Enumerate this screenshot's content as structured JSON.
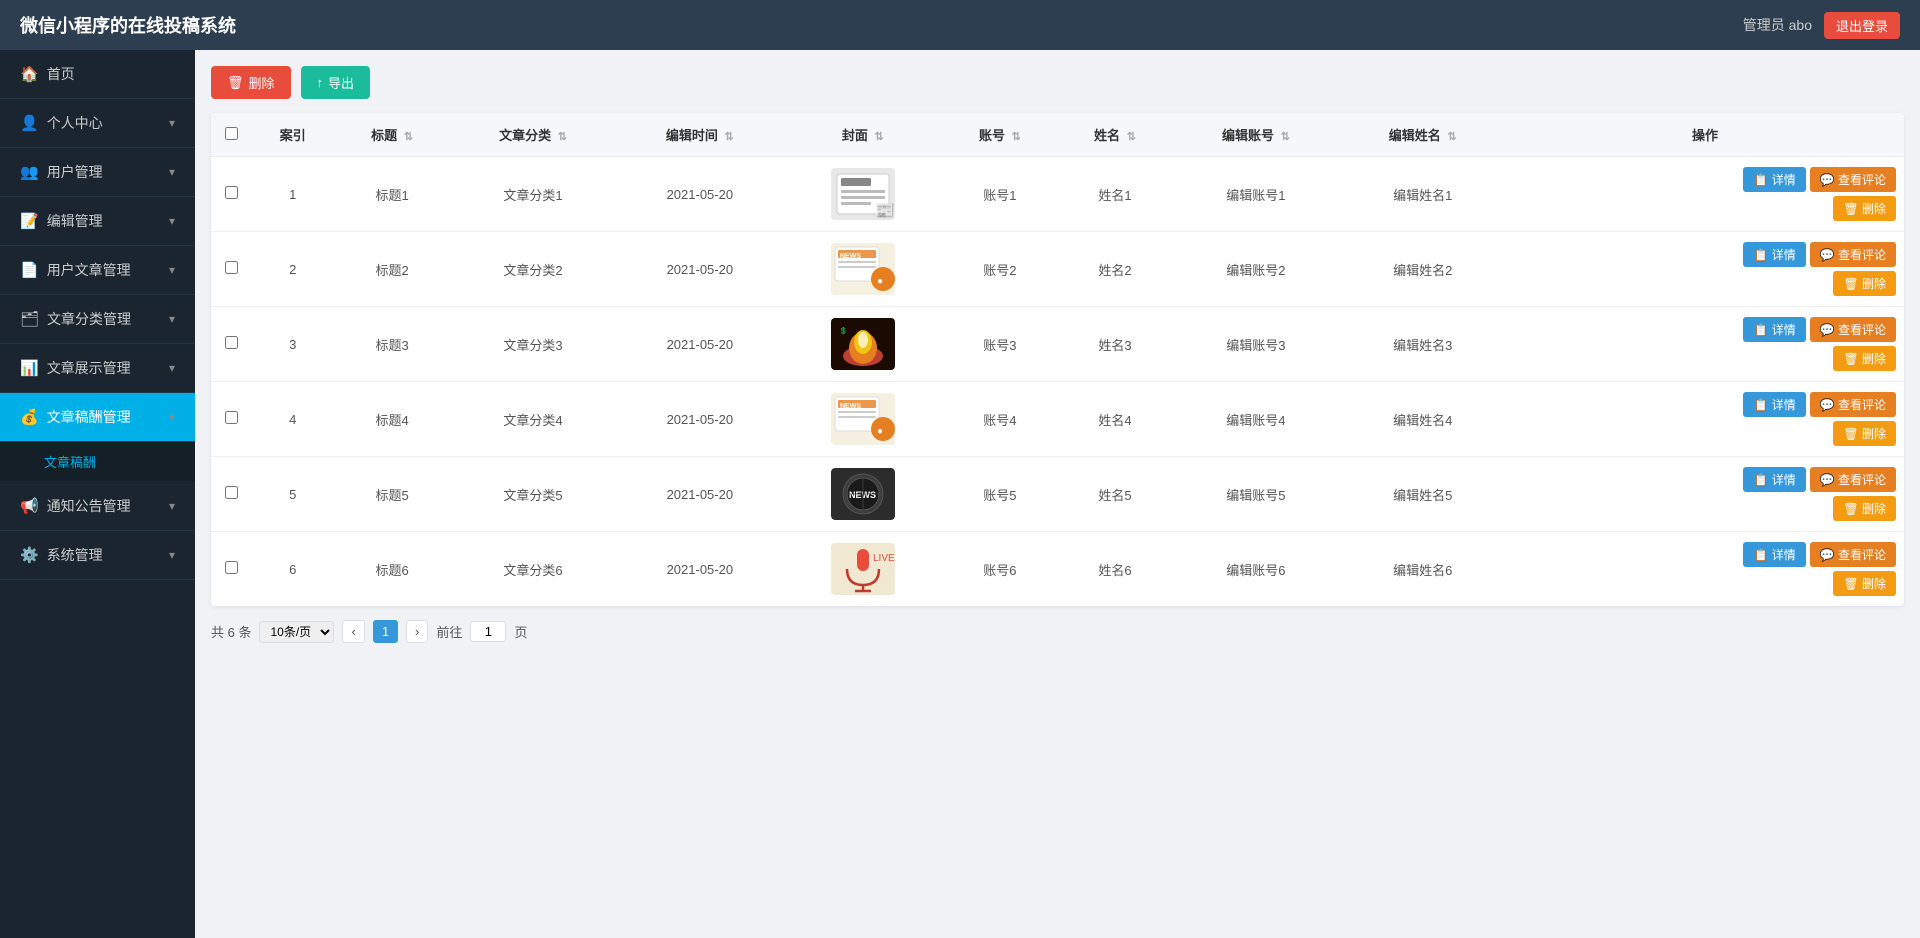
{
  "header": {
    "title": "微信小程序的在线投稿系统",
    "user_label": "管理员 abo",
    "logout_label": "退出登录"
  },
  "sidebar": {
    "items": [
      {
        "id": "home",
        "label": "首页",
        "icon": "🏠",
        "has_children": false
      },
      {
        "id": "profile",
        "label": "个人中心",
        "icon": "👤",
        "has_children": true
      },
      {
        "id": "user-mgmt",
        "label": "用户管理",
        "icon": "👥",
        "has_children": true
      },
      {
        "id": "editor-mgmt",
        "label": "编辑管理",
        "icon": "📝",
        "has_children": true
      },
      {
        "id": "user-article",
        "label": "用户文章管理",
        "icon": "📄",
        "has_children": true
      },
      {
        "id": "article-category",
        "label": "文章分类管理",
        "icon": "🗂",
        "has_children": true
      },
      {
        "id": "article-display",
        "label": "文章展示管理",
        "icon": "📊",
        "has_children": true
      },
      {
        "id": "article-reward",
        "label": "文章稿酬管理",
        "icon": "💰",
        "has_children": true,
        "active": true
      },
      {
        "id": "notice",
        "label": "通知公告管理",
        "icon": "📢",
        "has_children": true
      },
      {
        "id": "system",
        "label": "系统管理",
        "icon": "⚙️",
        "has_children": true
      }
    ],
    "sub_items": [
      {
        "id": "article-reward-sub",
        "label": "文章稿酬",
        "active": true
      }
    ]
  },
  "toolbar": {
    "delete_label": "删除",
    "export_label": "导出"
  },
  "table": {
    "columns": [
      {
        "id": "select",
        "label": ""
      },
      {
        "id": "index",
        "label": "案引"
      },
      {
        "id": "title",
        "label": "标题"
      },
      {
        "id": "category",
        "label": "文章分类"
      },
      {
        "id": "edit_time",
        "label": "编辑时间"
      },
      {
        "id": "cover",
        "label": "封面"
      },
      {
        "id": "account",
        "label": "账号"
      },
      {
        "id": "name",
        "label": "姓名"
      },
      {
        "id": "editor_account",
        "label": "编辑账号"
      },
      {
        "id": "editor_name",
        "label": "编辑姓名"
      },
      {
        "id": "action",
        "label": "操作"
      }
    ],
    "rows": [
      {
        "index": 1,
        "title": "标题1",
        "category": "文章分类1",
        "edit_time": "2021-05-20",
        "cover_type": "newspaper",
        "account": "账号1",
        "name": "姓名1",
        "editor_account": "编辑账号1",
        "editor_name": "编辑姓名1"
      },
      {
        "index": 2,
        "title": "标题2",
        "category": "文章分类2",
        "edit_time": "2021-05-20",
        "cover_type": "news-orange",
        "account": "账号2",
        "name": "姓名2",
        "editor_account": "编辑账号2",
        "editor_name": "编辑姓名2"
      },
      {
        "index": 3,
        "title": "标题3",
        "category": "文章分类3",
        "edit_time": "2021-05-20",
        "cover_type": "fire",
        "account": "账号3",
        "name": "姓名3",
        "editor_account": "编辑账号3",
        "editor_name": "编辑姓名3"
      },
      {
        "index": 4,
        "title": "标题4",
        "category": "文章分类4",
        "edit_time": "2021-05-20",
        "cover_type": "news-orange",
        "account": "账号4",
        "name": "姓名4",
        "editor_account": "编辑账号4",
        "editor_name": "编辑姓名4"
      },
      {
        "index": 5,
        "title": "标题5",
        "category": "文章分类5",
        "edit_time": "2021-05-20",
        "cover_type": "news-dark",
        "account": "账号5",
        "name": "姓名5",
        "editor_account": "编辑账号5",
        "editor_name": "编辑姓名5"
      },
      {
        "index": 6,
        "title": "标题6",
        "category": "文章分类6",
        "edit_time": "2021-05-20",
        "cover_type": "mic",
        "account": "账号6",
        "name": "姓名6",
        "editor_account": "编辑账号6",
        "editor_name": "编辑姓名6"
      }
    ],
    "action_buttons": {
      "detail": "详情",
      "comment": "查看评论",
      "delete": "删除"
    }
  },
  "pagination": {
    "total_text": "共 6 条",
    "page_size": "10条/页",
    "prev_label": "‹",
    "next_label": "›",
    "current_page": "1",
    "go_label": "前往",
    "page_label": "页"
  }
}
